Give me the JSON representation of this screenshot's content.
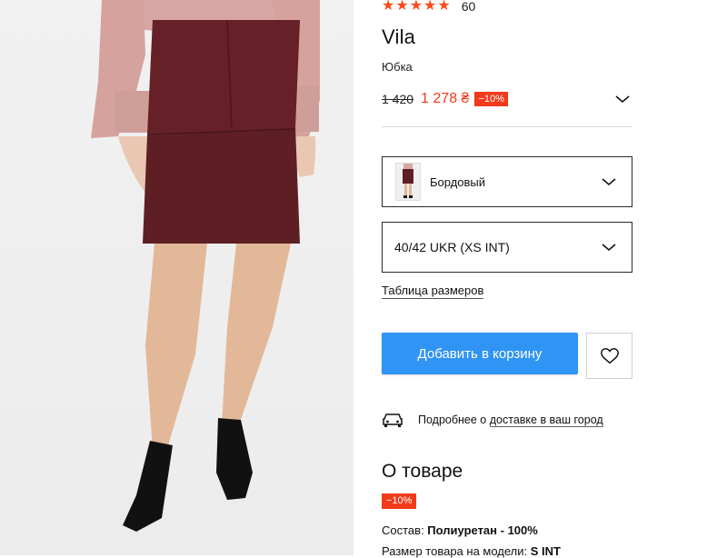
{
  "product": {
    "rating_stars": "★★★★★",
    "review_count": "60",
    "brand": "Vila",
    "type": "Юбка",
    "old_price": "1 420",
    "new_price": "1 278 ₴",
    "discount_badge": "−10%"
  },
  "selectors": {
    "color_label": "Бордовый",
    "size_label": "40/42 UKR (XS INT)",
    "size_table_link": "Таблица размеров"
  },
  "actions": {
    "add_to_cart": "Добавить в корзину",
    "wishlist_icon": "heart-icon"
  },
  "delivery": {
    "text_prefix": "Подробнее о ",
    "link_text": "доставке в ваш город"
  },
  "about": {
    "title": "О товаре",
    "badge": "−10%",
    "composition_label": "Состав: ",
    "composition_value": "Полиуретан - 100%",
    "model_size_label": "Размер товара на модели: ",
    "model_size_value": "S INT"
  },
  "colors": {
    "accent": "#f23a1b",
    "button": "#2f94f3",
    "skirt": "#5e1f24"
  }
}
